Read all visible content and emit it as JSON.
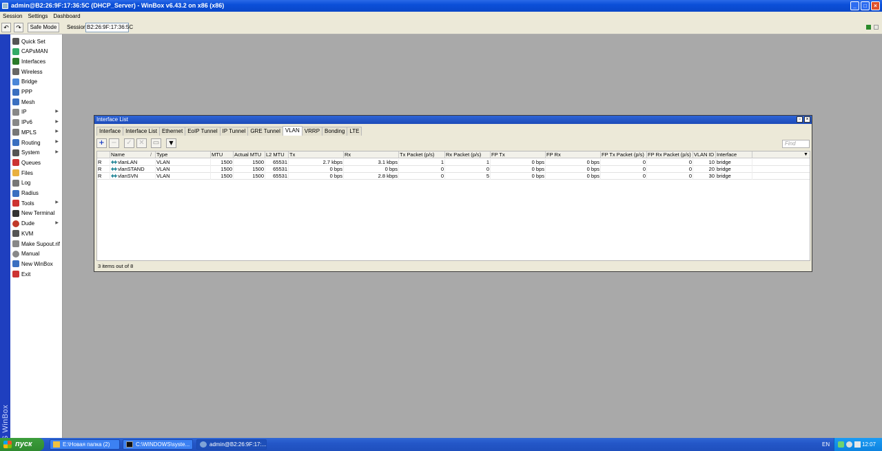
{
  "window": {
    "title": "admin@B2:26:9F:17:36:5C (DHCP_Server) - WinBox v6.43.2 on x86 (x86)",
    "min_glyph": "_",
    "max_glyph": "□",
    "close_glyph": "×"
  },
  "menu": [
    "Session",
    "Settings",
    "Dashboard"
  ],
  "toolbar": {
    "undo_glyph": "↶",
    "redo_glyph": "↷",
    "safe_mode_label": "Safe Mode",
    "session_label": "Session:",
    "session_value": "B2:26:9F:17:36:5C"
  },
  "vertical_brand": "RouterOS WinBox",
  "sidebar": [
    {
      "label": "Quick Set",
      "icon": "quick-set-icon",
      "submenu": false
    },
    {
      "label": "CAPsMAN",
      "icon": "capsman-icon",
      "submenu": false
    },
    {
      "label": "Interfaces",
      "icon": "interfaces-icon",
      "submenu": false
    },
    {
      "label": "Wireless",
      "icon": "wireless-icon",
      "submenu": false
    },
    {
      "label": "Bridge",
      "icon": "bridge-icon",
      "submenu": false
    },
    {
      "label": "PPP",
      "icon": "ppp-icon",
      "submenu": false
    },
    {
      "label": "Mesh",
      "icon": "mesh-icon",
      "submenu": false
    },
    {
      "label": "IP",
      "icon": "ip-icon",
      "submenu": true
    },
    {
      "label": "IPv6",
      "icon": "ipv6-icon",
      "submenu": true
    },
    {
      "label": "MPLS",
      "icon": "mpls-icon",
      "submenu": true
    },
    {
      "label": "Routing",
      "icon": "routing-icon",
      "submenu": true
    },
    {
      "label": "System",
      "icon": "system-icon",
      "submenu": true
    },
    {
      "label": "Queues",
      "icon": "queues-icon",
      "submenu": false
    },
    {
      "label": "Files",
      "icon": "files-icon",
      "submenu": false
    },
    {
      "label": "Log",
      "icon": "log-icon",
      "submenu": false
    },
    {
      "label": "Radius",
      "icon": "radius-icon",
      "submenu": false
    },
    {
      "label": "Tools",
      "icon": "tools-icon",
      "submenu": true
    },
    {
      "label": "New Terminal",
      "icon": "terminal-icon",
      "submenu": false
    },
    {
      "label": "Dude",
      "icon": "dude-icon",
      "submenu": true
    },
    {
      "label": "KVM",
      "icon": "kvm-icon",
      "submenu": false
    },
    {
      "label": "Make Supout.rif",
      "icon": "supout-icon",
      "submenu": false
    },
    {
      "label": "Manual",
      "icon": "manual-icon",
      "submenu": false
    },
    {
      "label": "New WinBox",
      "icon": "winbox-icon",
      "submenu": false
    },
    {
      "label": "Exit",
      "icon": "exit-icon",
      "submenu": false
    }
  ],
  "submenu_arrow": "▶",
  "interface_window": {
    "title": "Interface List",
    "restore_glyph": "▫",
    "close_glyph": "×",
    "tabs": [
      "Interface",
      "Interface List",
      "Ethernet",
      "EoIP Tunnel",
      "IP Tunnel",
      "GRE Tunnel",
      "VLAN",
      "VRRP",
      "Bonding",
      "LTE"
    ],
    "active_tab": "VLAN",
    "tool_glyphs": {
      "add": "+",
      "remove": "−",
      "enable": "✓",
      "disable": "✕",
      "comment": "▭",
      "filter": "▼"
    },
    "find_placeholder": "Find",
    "sort_glyph": "/",
    "columns_menu_glyph": "▼",
    "columns": [
      "",
      "Name",
      "Type",
      "MTU",
      "Actual MTU",
      "L2 MTU",
      "Tx",
      "Rx",
      "Tx Packet (p/s)",
      "Rx Packet (p/s)",
      "FP Tx",
      "FP Rx",
      "FP Tx Packet (p/s)",
      "FP Rx Packet (p/s)",
      "VLAN ID",
      "Interface"
    ],
    "rows": [
      {
        "flag": "R",
        "name": "vlanLAN",
        "type": "VLAN",
        "mtu": "1500",
        "actual_mtu": "1500",
        "l2_mtu": "65531",
        "tx": "2.7 kbps",
        "rx": "3.1 kbps",
        "tx_pps": "1",
        "rx_pps": "1",
        "fp_tx": "0 bps",
        "fp_rx": "0 bps",
        "fp_tx_pps": "0",
        "fp_rx_pps": "0",
        "vlan_id": "10",
        "interface": "bridge"
      },
      {
        "flag": "R",
        "name": "vlanSTAND",
        "type": "VLAN",
        "mtu": "1500",
        "actual_mtu": "1500",
        "l2_mtu": "65531",
        "tx": "0 bps",
        "rx": "0 bps",
        "tx_pps": "0",
        "rx_pps": "0",
        "fp_tx": "0 bps",
        "fp_rx": "0 bps",
        "fp_tx_pps": "0",
        "fp_rx_pps": "0",
        "vlan_id": "20",
        "interface": "bridge"
      },
      {
        "flag": "R",
        "name": "vlanSVN",
        "type": "VLAN",
        "mtu": "1500",
        "actual_mtu": "1500",
        "l2_mtu": "65531",
        "tx": "0 bps",
        "rx": "2.8 kbps",
        "tx_pps": "0",
        "rx_pps": "5",
        "fp_tx": "0 bps",
        "fp_rx": "0 bps",
        "fp_tx_pps": "0",
        "fp_rx_pps": "0",
        "vlan_id": "30",
        "interface": "bridge"
      }
    ],
    "status": "3 items out of 8"
  },
  "taskbar": {
    "start_label": "пуск",
    "tasks": [
      "E:\\Новая папка (2)",
      "C:\\WINDOWS\\syste...",
      "admin@B2:26:9F:17:..."
    ],
    "language": "EN",
    "clock": "12:07"
  },
  "colors": {
    "accent": "#1f3fbf",
    "title_bar": "#0b4fd8",
    "taskbar": "#2457c8",
    "start": "#2f8a2f"
  }
}
